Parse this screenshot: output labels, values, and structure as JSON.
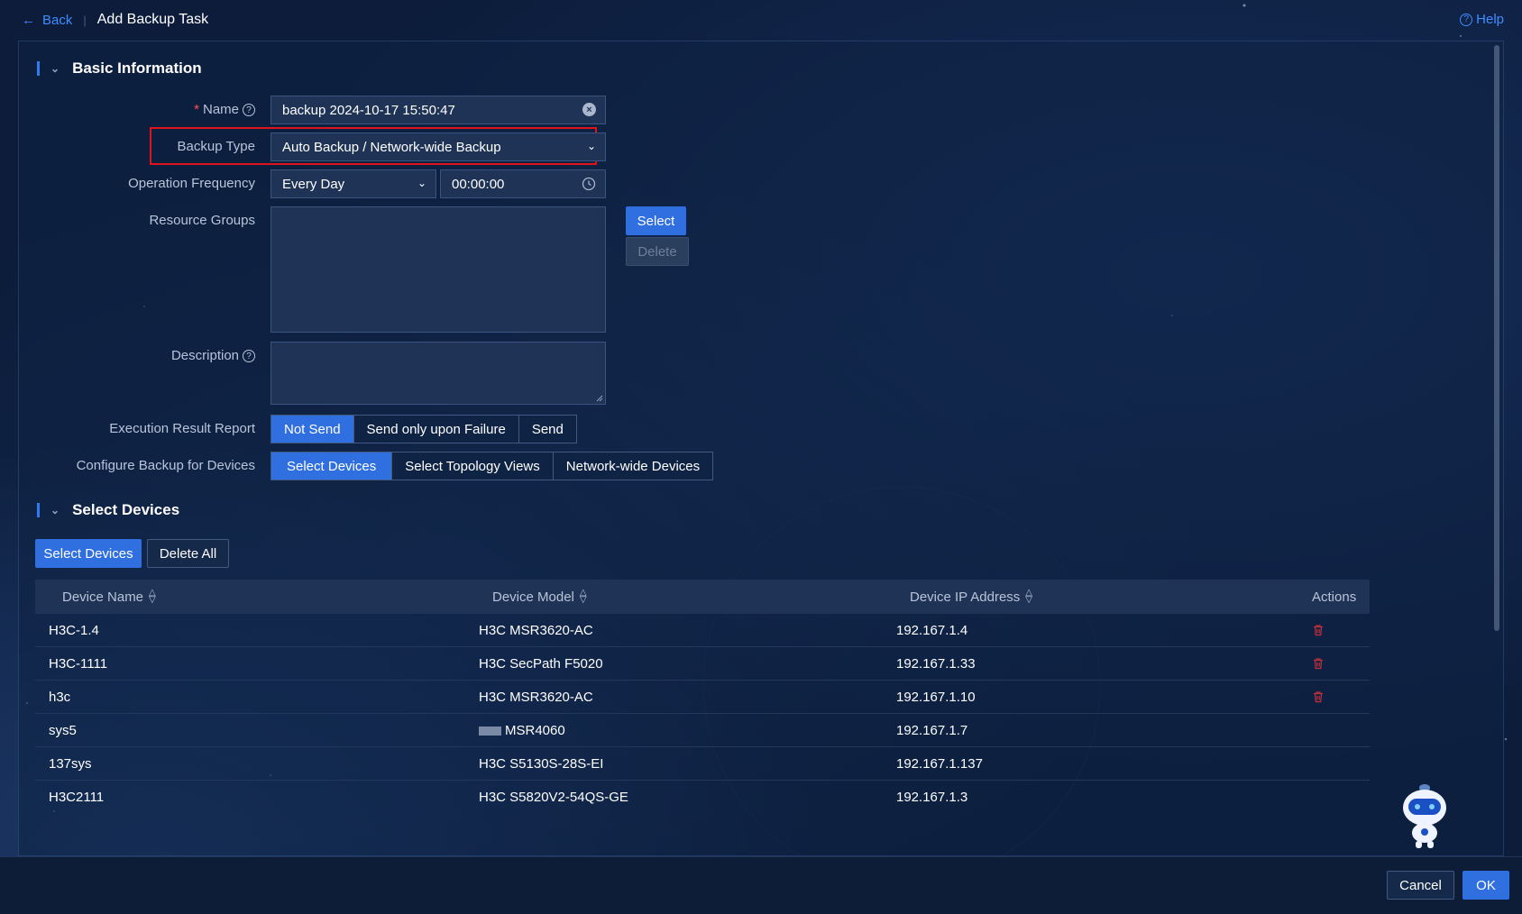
{
  "header": {
    "back_label": "Back",
    "separator": "|",
    "title": "Add Backup Task",
    "help_label": "Help"
  },
  "basic_section": {
    "title": "Basic Information",
    "name_label": "Name",
    "name_value": "backup 2024-10-17 15:50:47",
    "backup_type_label": "Backup Type",
    "backup_type_value": "Auto Backup / Network-wide Backup",
    "frequency_label": "Operation Frequency",
    "frequency_value": "Every Day",
    "time_value": "00:00:00",
    "resource_groups_label": "Resource Groups",
    "select_button": "Select",
    "delete_button": "Delete",
    "description_label": "Description",
    "result_report_label": "Execution Result Report",
    "result_report_options": [
      "Not Send",
      "Send only upon Failure",
      "Send"
    ],
    "result_report_selected": "Not Send",
    "configure_label": "Configure Backup for Devices",
    "configure_options": [
      "Select Devices",
      "Select Topology Views",
      "Network-wide Devices"
    ],
    "configure_selected": "Select Devices"
  },
  "devices_section": {
    "title": "Select Devices",
    "select_devices_button": "Select Devices",
    "delete_all_button": "Delete All",
    "columns": [
      "Device Name",
      "Device Model",
      "Device IP Address",
      "Actions"
    ],
    "rows": [
      {
        "name": "H3C-1.4",
        "model": "H3C MSR3620-AC",
        "ip": "192.167.1.4"
      },
      {
        "name": "H3C-1111",
        "model": "H3C SecPath F5020",
        "ip": "192.167.1.33"
      },
      {
        "name": "h3c",
        "model": "H3C MSR3620-AC",
        "ip": "192.167.1.10"
      },
      {
        "name": "sys5",
        "model": "MSR4060",
        "ip": "192.167.1.7"
      },
      {
        "name": "137sys",
        "model": "H3C S5130S-28S-EI",
        "ip": "192.167.1.137"
      },
      {
        "name": "H3C2111",
        "model": "H3C S5820V2-54QS-GE",
        "ip": "192.167.1.3"
      }
    ]
  },
  "footer": {
    "cancel_button": "Cancel",
    "ok_button": "OK"
  },
  "colors": {
    "accent": "#2f6fe0",
    "link": "#3f8cff",
    "danger": "#e0121a",
    "background": "#0c1c3a"
  }
}
